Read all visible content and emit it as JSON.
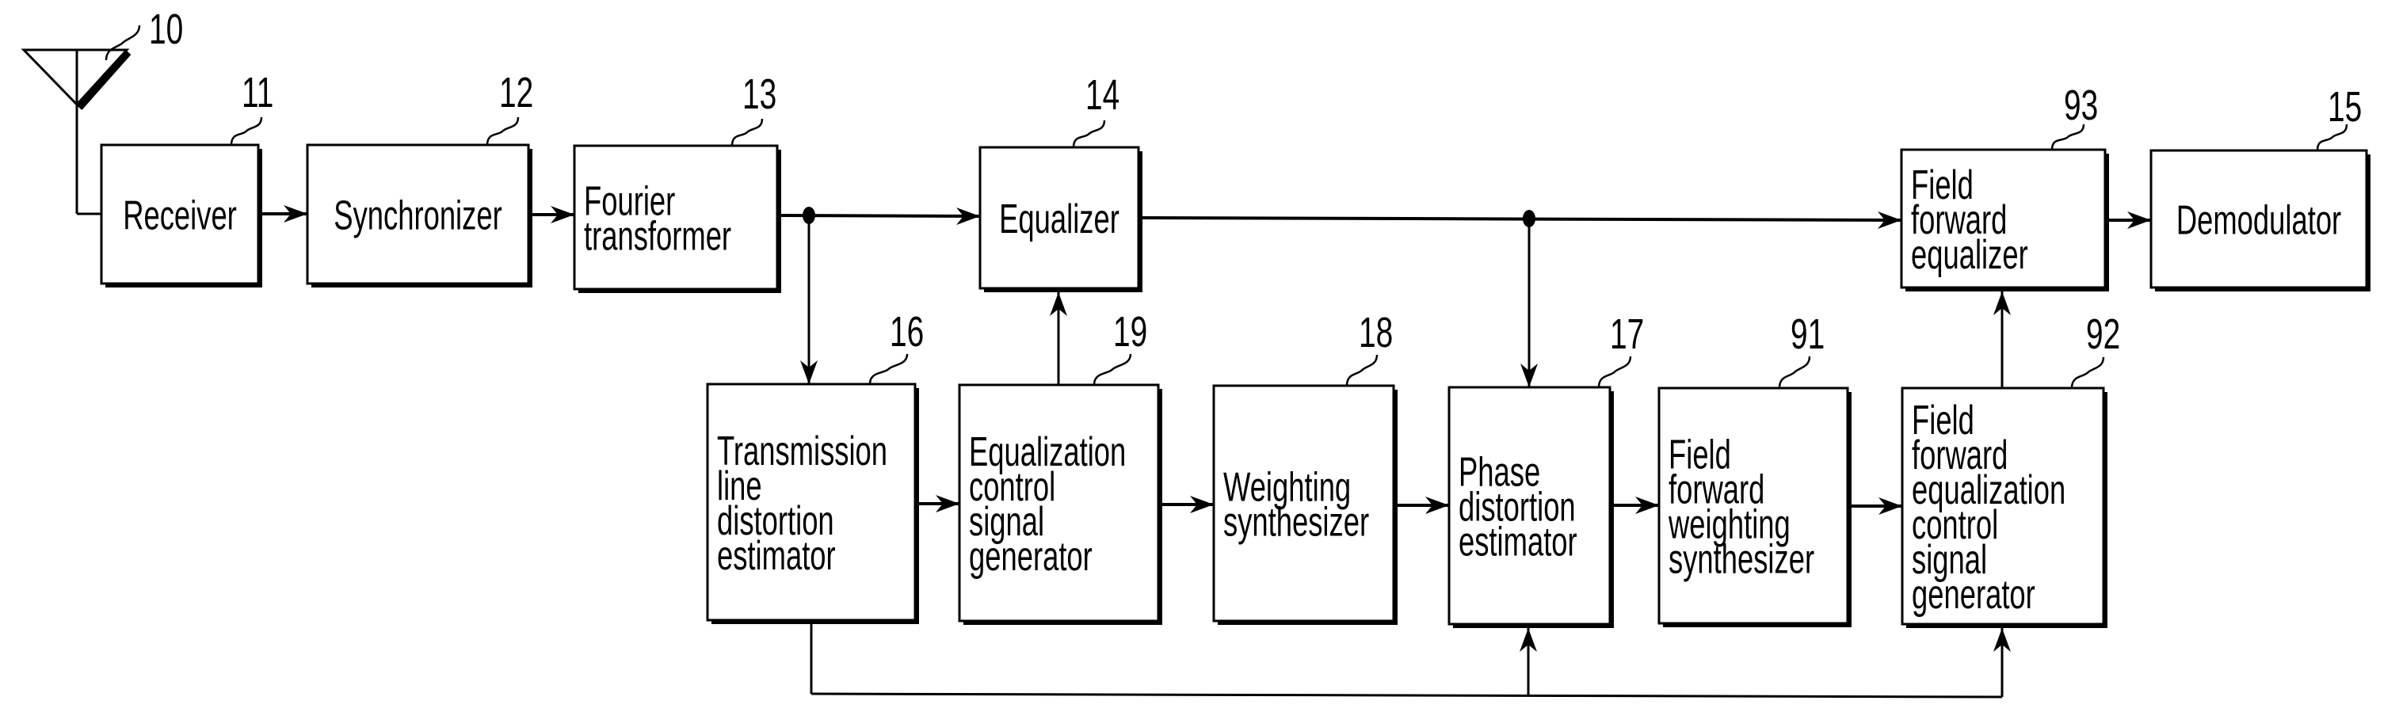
{
  "figure": {
    "type": "block diagram",
    "antenna": {
      "ref": "10",
      "icon": "antenna-icon"
    },
    "blocks": [
      {
        "id": "receiver",
        "ref": "11",
        "lines": [
          "Receiver"
        ]
      },
      {
        "id": "synchronizer",
        "ref": "12",
        "lines": [
          "Synchronizer"
        ]
      },
      {
        "id": "fourier-transformer",
        "ref": "13",
        "lines": [
          "Fourier",
          "transformer"
        ]
      },
      {
        "id": "equalizer",
        "ref": "14",
        "lines": [
          "Equalizer"
        ]
      },
      {
        "id": "field-forward-equalizer",
        "ref": "93",
        "lines": [
          "Field",
          "forward",
          "equalizer"
        ]
      },
      {
        "id": "demodulator",
        "ref": "15",
        "lines": [
          "Demodulator"
        ]
      },
      {
        "id": "transmission-line-distortion-estimator",
        "ref": "16",
        "lines": [
          "Transmission",
          "line",
          "distortion",
          "estimator"
        ]
      },
      {
        "id": "equalization-control-signal-generator",
        "ref": "19",
        "lines": [
          "Equalization",
          "control",
          "signal",
          "generator"
        ]
      },
      {
        "id": "weighting-synthesizer",
        "ref": "18",
        "lines": [
          "Weighting",
          "synthesizer"
        ]
      },
      {
        "id": "phase-distortion-estimator",
        "ref": "17",
        "lines": [
          "Phase",
          "distortion",
          "estimator"
        ]
      },
      {
        "id": "field-forward-weighting-synthesizer",
        "ref": "91",
        "lines": [
          "Field",
          "forward",
          "weighting",
          "synthesizer"
        ]
      },
      {
        "id": "field-forward-equalization-control-signal-generator",
        "ref": "92",
        "lines": [
          "Field",
          "forward",
          "equalization",
          "control",
          "signal",
          "generator"
        ]
      }
    ],
    "connections": [
      {
        "from": "antenna",
        "to": "receiver"
      },
      {
        "from": "receiver",
        "to": "synchronizer"
      },
      {
        "from": "synchronizer",
        "to": "fourier-transformer"
      },
      {
        "from": "fourier-transformer",
        "to": "equalizer"
      },
      {
        "from": "fourier-transformer",
        "to": "transmission-line-distortion-estimator"
      },
      {
        "from": "equalizer",
        "to": "field-forward-equalizer"
      },
      {
        "from": "equalizer",
        "to": "phase-distortion-estimator"
      },
      {
        "from": "field-forward-equalizer",
        "to": "demodulator"
      },
      {
        "from": "transmission-line-distortion-estimator",
        "to": "equalization-control-signal-generator"
      },
      {
        "from": "equalization-control-signal-generator",
        "to": "equalizer"
      },
      {
        "from": "equalization-control-signal-generator",
        "to": "weighting-synthesizer"
      },
      {
        "from": "weighting-synthesizer",
        "to": "phase-distortion-estimator"
      },
      {
        "from": "phase-distortion-estimator",
        "to": "field-forward-weighting-synthesizer"
      },
      {
        "from": "field-forward-weighting-synthesizer",
        "to": "field-forward-equalization-control-signal-generator"
      },
      {
        "from": "field-forward-equalization-control-signal-generator",
        "to": "field-forward-equalizer"
      },
      {
        "from": "transmission-line-distortion-estimator",
        "to": "phase-distortion-estimator"
      },
      {
        "from": "transmission-line-distortion-estimator",
        "to": "field-forward-equalization-control-signal-generator"
      }
    ]
  }
}
